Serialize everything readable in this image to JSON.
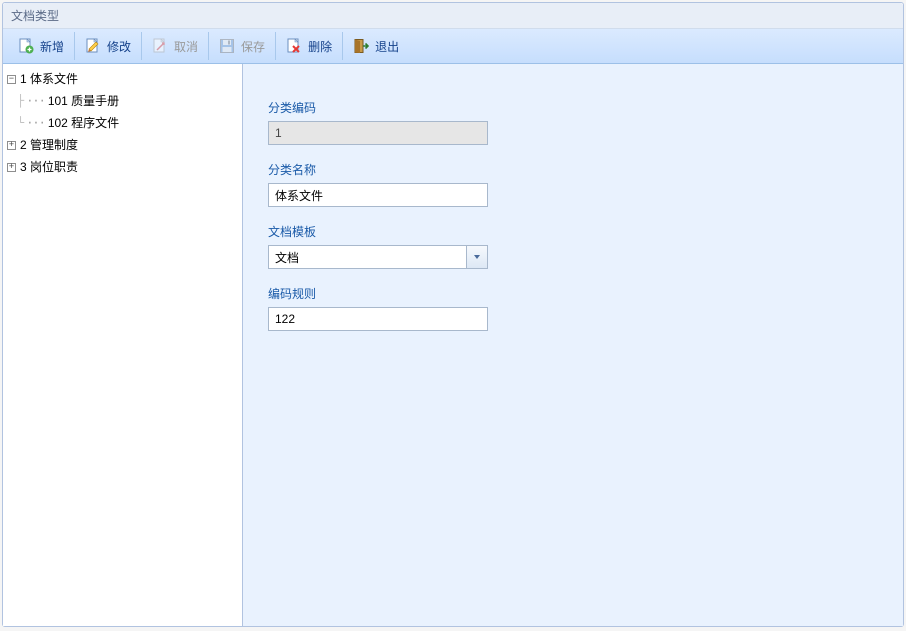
{
  "window": {
    "title": "文档类型"
  },
  "toolbar": {
    "add": {
      "label": "新增",
      "enabled": true
    },
    "edit": {
      "label": "修改",
      "enabled": true
    },
    "cancel": {
      "label": "取消",
      "enabled": false
    },
    "save": {
      "label": "保存",
      "enabled": false
    },
    "delete": {
      "label": "删除",
      "enabled": true
    },
    "exit": {
      "label": "退出",
      "enabled": true
    }
  },
  "tree": {
    "nodes": [
      {
        "id": "1",
        "label": "1 体系文件",
        "expanded": true,
        "hasChildren": true,
        "children": [
          {
            "id": "101",
            "label": "101 质量手册"
          },
          {
            "id": "102",
            "label": "102 程序文件"
          }
        ]
      },
      {
        "id": "2",
        "label": "2 管理制度",
        "expanded": false,
        "hasChildren": true,
        "children": []
      },
      {
        "id": "3",
        "label": "3 岗位职责",
        "expanded": false,
        "hasChildren": true,
        "children": []
      }
    ]
  },
  "form": {
    "code": {
      "label": "分类编码",
      "value": "1",
      "readonly": true
    },
    "name": {
      "label": "分类名称",
      "value": "体系文件",
      "readonly": false
    },
    "template": {
      "label": "文档模板",
      "value": "文档",
      "readonly": false
    },
    "rule": {
      "label": "编码规则",
      "value": "122",
      "readonly": false
    }
  }
}
